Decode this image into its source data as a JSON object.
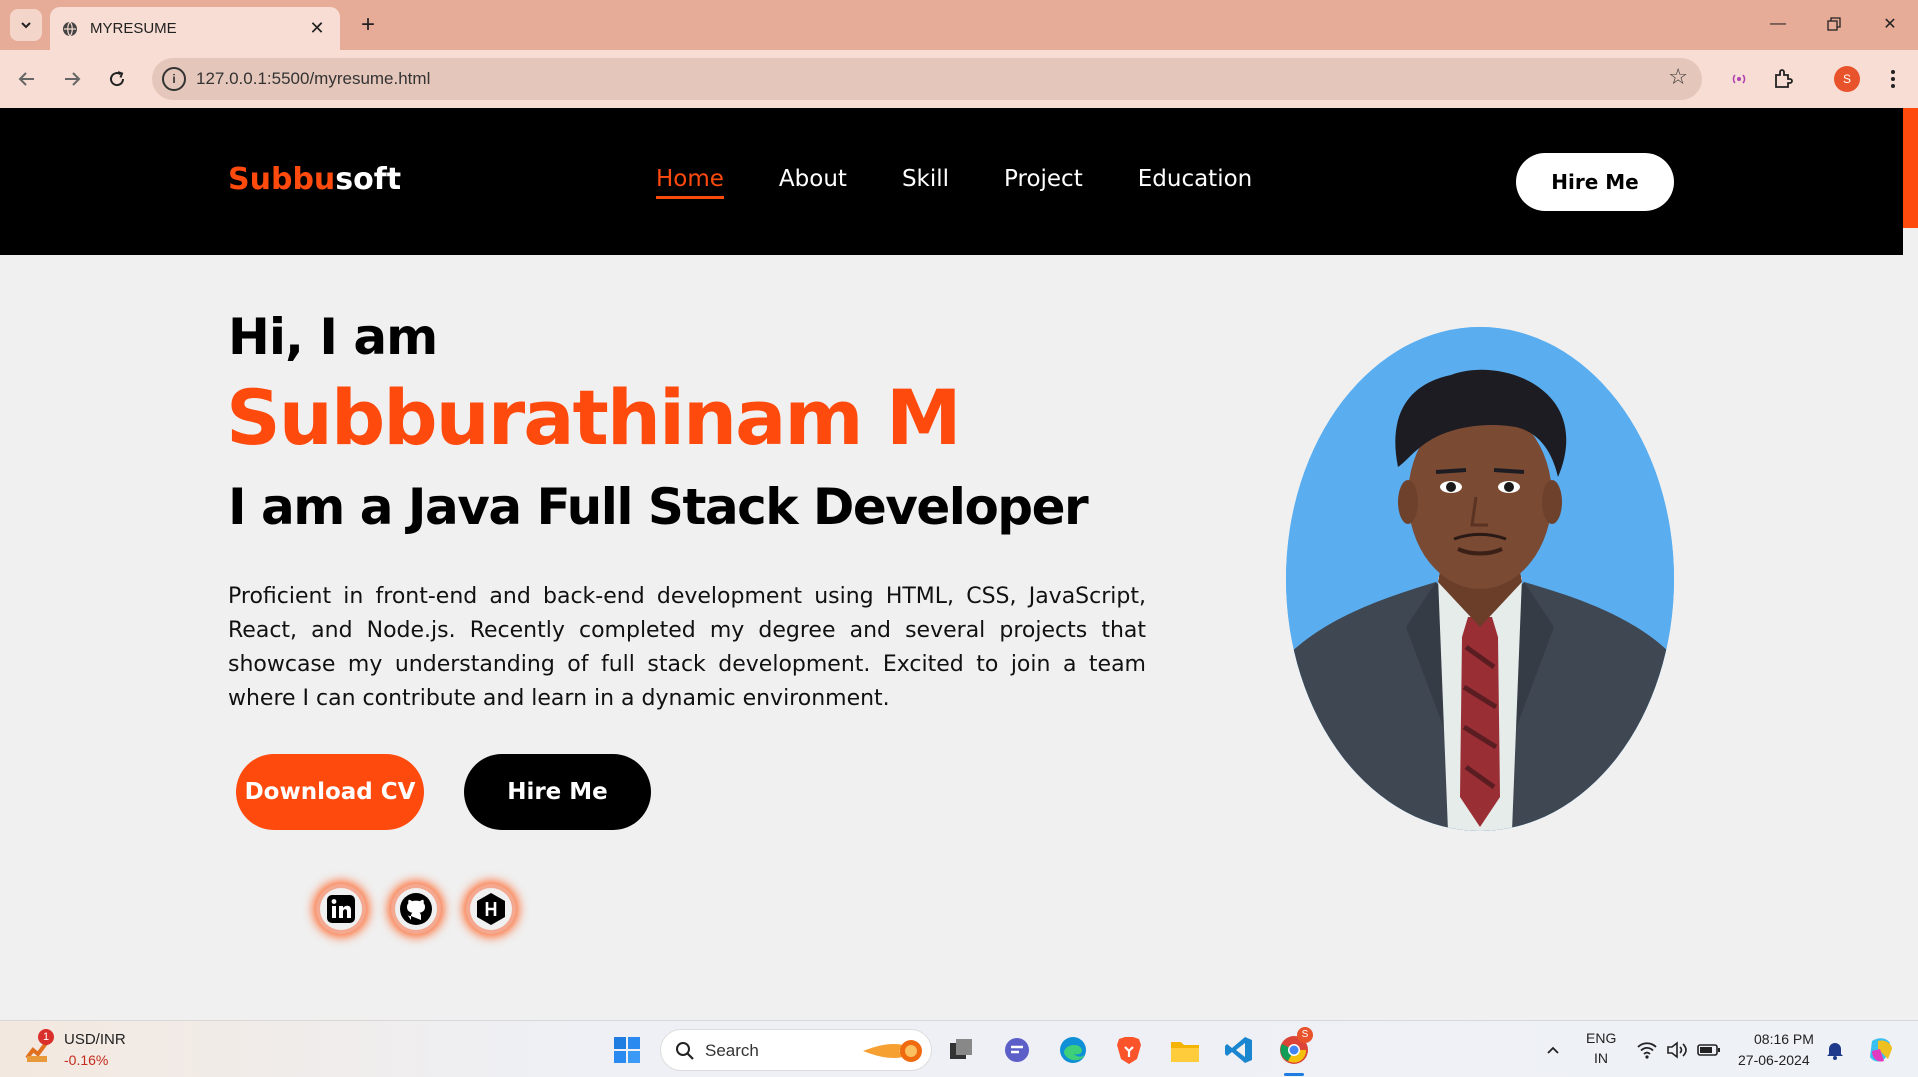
{
  "browser": {
    "tab_title": "MYRESUME",
    "url": "127.0.0.1:5500/myresume.html",
    "profile_initial": "S"
  },
  "site": {
    "logo_part1": "Subbu",
    "logo_part2": "soft",
    "nav": [
      {
        "label": "Home",
        "active": true
      },
      {
        "label": "About",
        "active": false
      },
      {
        "label": "Skill",
        "active": false
      },
      {
        "label": "Project",
        "active": false
      },
      {
        "label": "Education",
        "active": false
      }
    ],
    "hire_top_label": "Hire Me",
    "accent_color": "#ff4a0e"
  },
  "hero": {
    "greeting": "Hi, I am",
    "name": "Subburathinam M",
    "role": "I am a Java Full Stack Developer",
    "bio": "Proficient in front-end and back-end development using HTML, CSS, JavaScript, React, and Node.js. Recently completed my degree and several projects that showcase my understanding of full stack development. Excited to join a team where I can contribute and learn in a dynamic environment.",
    "download_label": "Download CV",
    "hire_label": "Hire Me",
    "socials": [
      {
        "icon": "linkedin-icon"
      },
      {
        "icon": "github-icon"
      },
      {
        "icon": "hackerrank-icon"
      }
    ]
  },
  "taskbar": {
    "ticker_name": "USD/INR",
    "ticker_change": "-0.16%",
    "ticker_badge": "1",
    "search_placeholder": "Search",
    "lang_top": "ENG",
    "lang_bottom": "IN",
    "time": "08:16 PM",
    "date": "27-06-2024",
    "chrome_badge": "S"
  }
}
